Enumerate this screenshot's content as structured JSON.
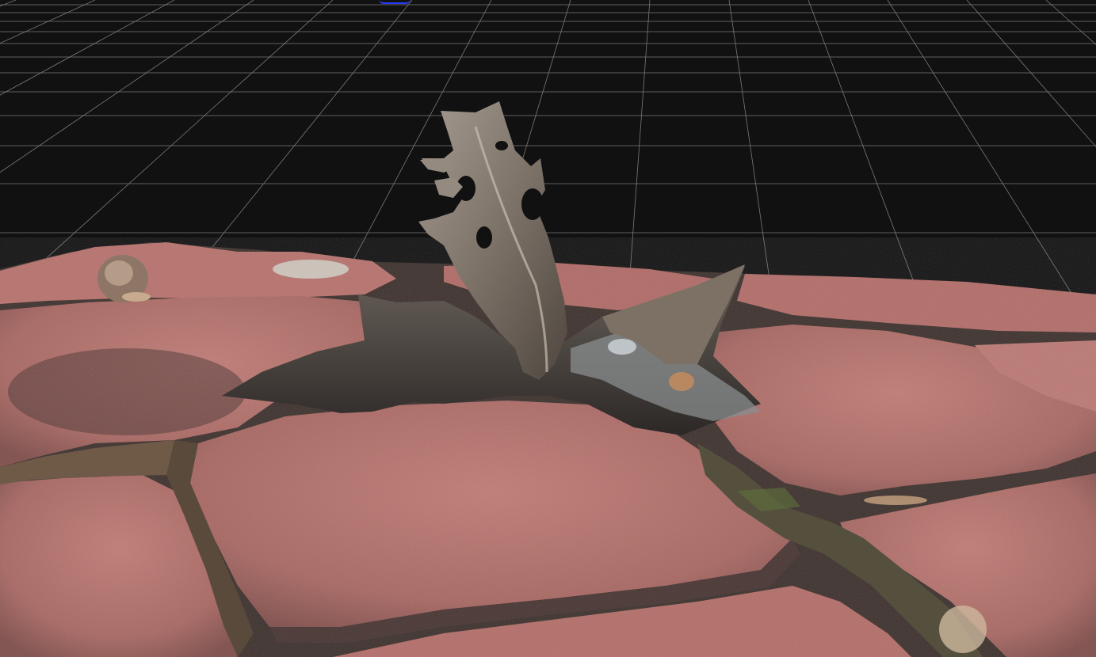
{
  "app": {
    "view": "3d-mesh-viewport",
    "background_color": "#111111",
    "grid_color": "#8c8c8c",
    "gizmo_color": "#2a3cff"
  },
  "scene": {
    "model": "photogrammetry-scan-paving-stones-with-dandelion",
    "stone_color": "#b7716c",
    "stone_dark_color": "#5a3c3b",
    "leaf_color": "#8b8177",
    "debris_color": "#48423e"
  }
}
